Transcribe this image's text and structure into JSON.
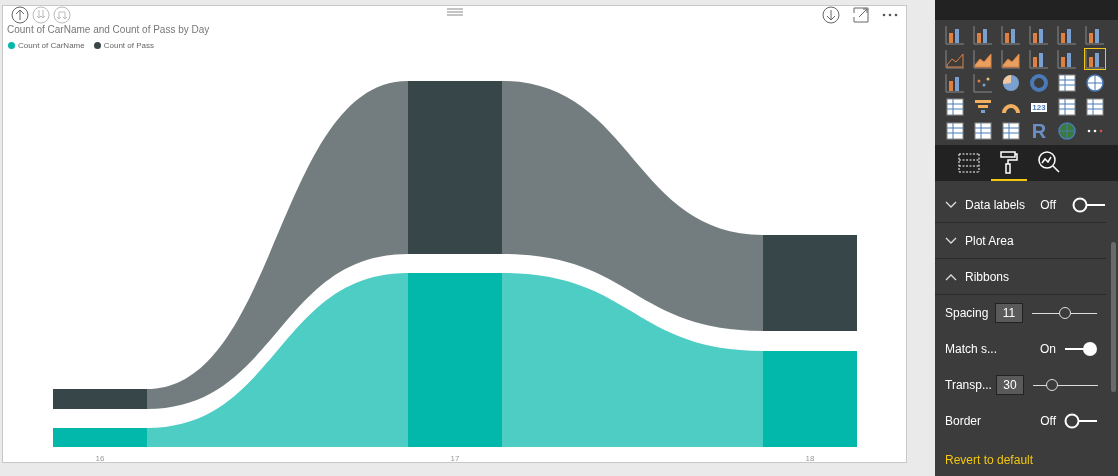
{
  "visual": {
    "title": "Count of CarName and Count of Pass by Day",
    "legend": [
      {
        "label": "Count of CarName",
        "color": "#01b8aa"
      },
      {
        "label": "Count of Pass",
        "color": "#374649"
      }
    ],
    "x_labels": [
      "16",
      "17",
      "18"
    ]
  },
  "pane": {
    "gallery": [
      {
        "selected": false
      },
      {
        "selected": false
      },
      {
        "selected": false
      },
      {
        "selected": false
      },
      {
        "selected": false
      },
      {
        "selected": false
      },
      {
        "selected": false
      },
      {
        "selected": false
      },
      {
        "selected": false
      },
      {
        "selected": false
      },
      {
        "selected": false
      },
      {
        "selected": true
      },
      {
        "selected": false
      },
      {
        "selected": false
      },
      {
        "selected": false
      },
      {
        "selected": false
      },
      {
        "selected": false
      },
      {
        "selected": false
      },
      {
        "selected": false
      },
      {
        "selected": false
      },
      {
        "selected": false
      },
      {
        "selected": false,
        "glyph": "123"
      },
      {
        "selected": false
      },
      {
        "selected": false
      },
      {
        "selected": false
      },
      {
        "selected": false
      },
      {
        "selected": false
      },
      {
        "selected": false,
        "glyph": "R"
      },
      {
        "selected": false
      },
      {
        "selected": false
      }
    ],
    "tabs": [
      {
        "selected": false
      },
      {
        "selected": true
      },
      {
        "selected": false
      }
    ],
    "sections": [
      {
        "label": "Data labels",
        "expanded": false,
        "toggle": {
          "state_text": "Off",
          "on": false
        }
      },
      {
        "label": "Plot Area",
        "expanded": false
      },
      {
        "label": "Ribbons",
        "expanded": true,
        "settings": [
          {
            "kind": "slider",
            "label": "Spacing",
            "value": "11",
            "level": 0.5
          },
          {
            "kind": "toggle",
            "label": "Match s...",
            "state_text": "On",
            "on": true
          },
          {
            "kind": "slider",
            "label": "Transp...",
            "value": "30",
            "level": 0.3
          },
          {
            "kind": "toggle",
            "label": "Border",
            "state_text": "Off",
            "on": false
          }
        ]
      }
    ],
    "revert_link": "Revert to default"
  }
}
